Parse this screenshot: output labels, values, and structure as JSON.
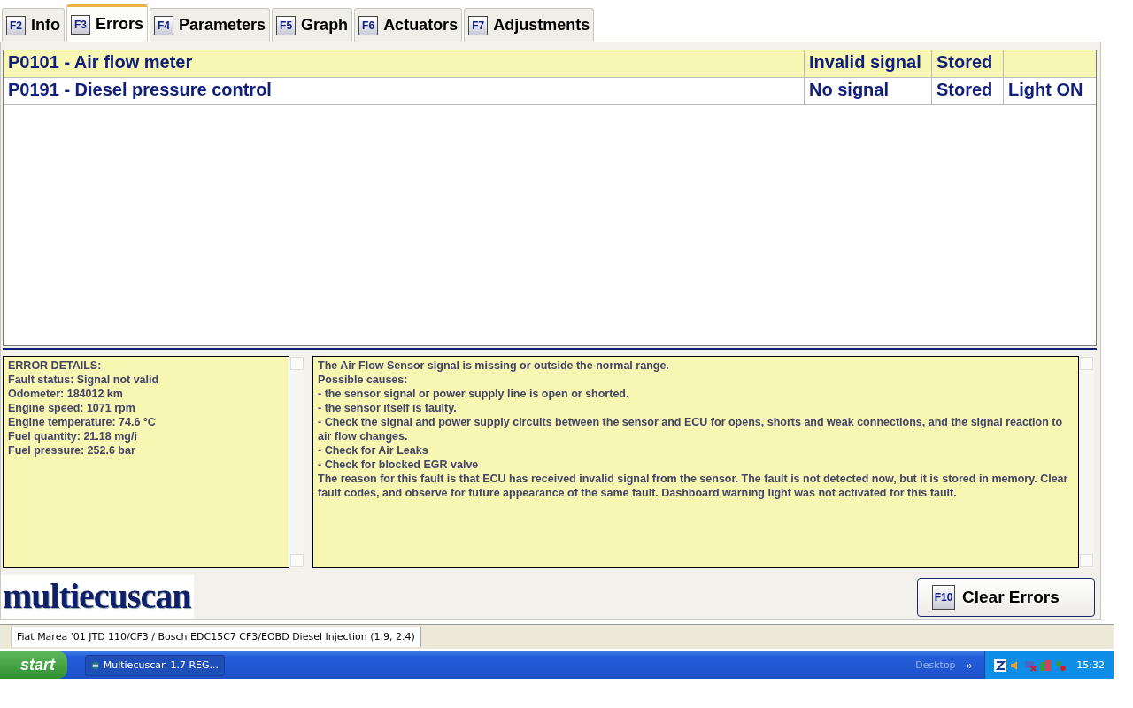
{
  "tabs": [
    {
      "key": "F2",
      "label": "Info",
      "selected": false
    },
    {
      "key": "F3",
      "label": "Errors",
      "selected": true
    },
    {
      "key": "F4",
      "label": "Parameters",
      "selected": false
    },
    {
      "key": "F5",
      "label": "Graph",
      "selected": false
    },
    {
      "key": "F6",
      "label": "Actuators",
      "selected": false
    },
    {
      "key": "F7",
      "label": "Adjustments",
      "selected": false
    }
  ],
  "errors": [
    {
      "description": "P0101 - Air flow meter",
      "status": "Invalid signal",
      "stored": "Stored",
      "selected": true
    },
    {
      "description": "P0191 - Diesel pressure control",
      "status": "No signal",
      "stored": "Stored",
      "light": "Light ON",
      "selected": false
    }
  ],
  "details": [
    "ERROR DETAILS:",
    "Fault status: Signal not valid",
    "Odometer: 184012 km",
    "Engine speed: 1071 rpm",
    "Engine temperature: 74.6 °C",
    "Fuel quantity: 21.18 mg/i",
    "Fuel pressure: 252.6 bar"
  ],
  "description": [
    "The Air Flow Sensor signal is missing or outside the normal range.",
    "Possible causes:",
    "- the sensor signal or power supply line is open or shorted.",
    "- the sensor itself is faulty.",
    "- Check the signal and power supply circuits between the sensor and ECU for opens, shorts and weak connections, and the signal reaction to air flow changes.",
    "- Check for Air Leaks",
    "- Check for blocked EGR valve",
    "The reason for this fault is that ECU has received invalid signal from the sensor. The fault is not detected now, but it is stored in memory. Clear fault codes, and observe for future appearance of the same fault. Dashboard warning light was not activated for this fault."
  ],
  "logo": "multiecuscan",
  "clear_button": {
    "key": "F10",
    "label": "Clear Errors"
  },
  "status_bar": "Fiat Marea '01 JTD 110/CF3 / Bosch EDC15C7 CF3/EOBD Diesel Injection (1.9, 2.4)",
  "taskbar": {
    "start": "start",
    "task": "Multiecuscan 1.7 REG...",
    "toolbar": "Desktop",
    "chevron": "»",
    "clock": "15:32"
  }
}
